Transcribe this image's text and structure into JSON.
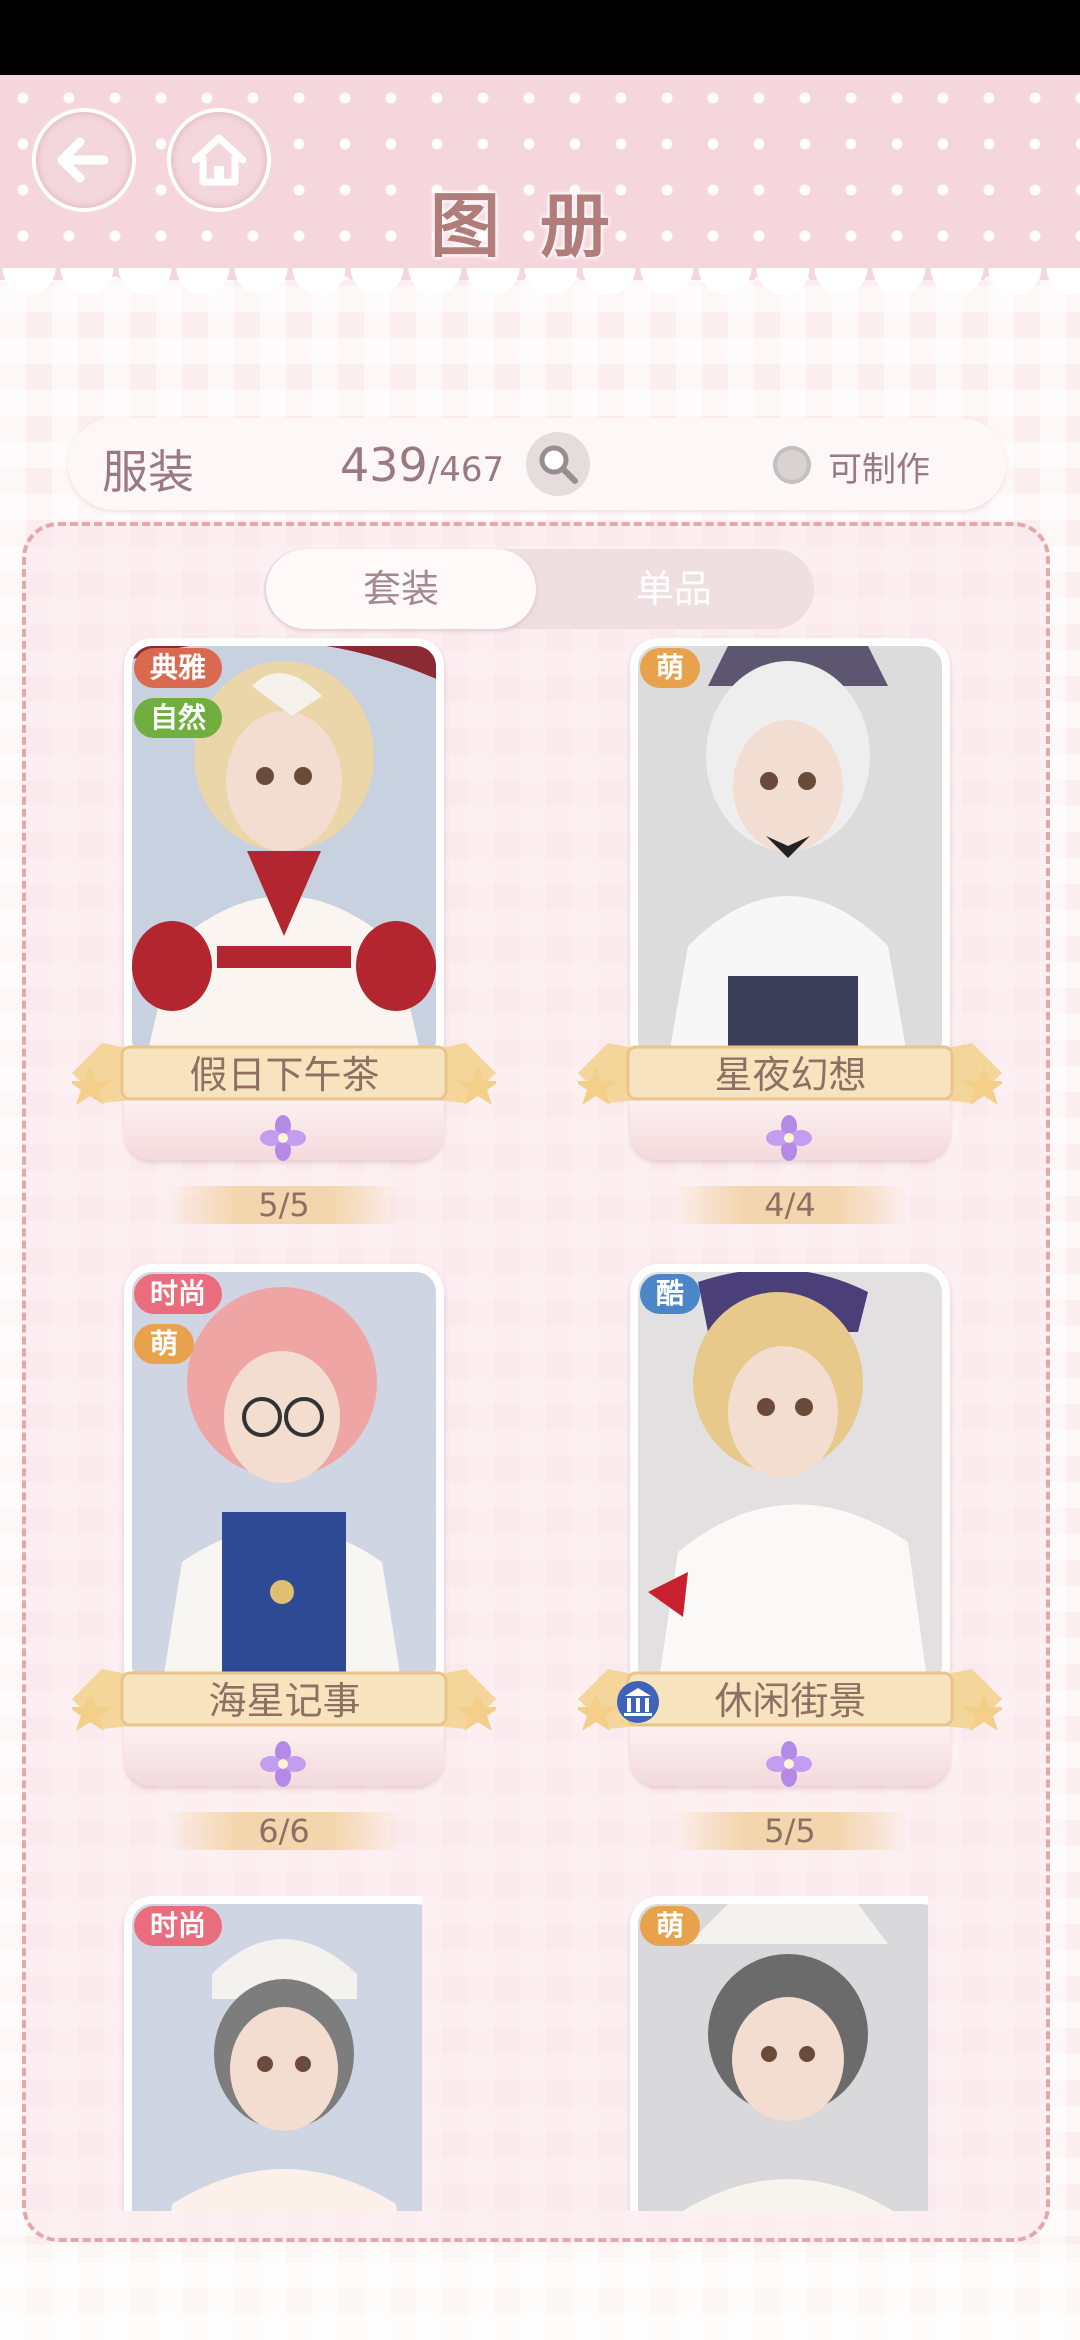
{
  "header": {
    "title": "图册"
  },
  "stats": {
    "category": "服装",
    "owned": "439",
    "total": "467",
    "craftable_label": "可制作"
  },
  "tabs": [
    {
      "label": "套装",
      "active": true
    },
    {
      "label": "单品",
      "active": false
    }
  ],
  "cards": [
    {
      "name": "假日下午茶",
      "tags": [
        "典雅",
        "自然"
      ],
      "progress": "5/5"
    },
    {
      "name": "星夜幻想",
      "tags": [
        "萌"
      ],
      "progress": "4/4"
    },
    {
      "name": "海星记事",
      "tags": [
        "时尚",
        "萌"
      ],
      "progress": "6/6"
    },
    {
      "name": "休闲街景",
      "tags": [
        "酷"
      ],
      "progress": "5/5"
    },
    {
      "name": "",
      "tags": [
        "时尚"
      ],
      "progress": ""
    },
    {
      "name": "",
      "tags": [
        "萌"
      ],
      "progress": ""
    }
  ],
  "colors": {
    "header_pink": "#f6d6dd",
    "title": "#b07d7a",
    "tag_elegant": "#d9694f",
    "tag_nature": "#6fae3f",
    "tag_cute": "#e8a24c",
    "tag_fashion": "#e96d7c",
    "tag_cool": "#4b86c9"
  },
  "icons": {
    "back": "arrow-left-icon",
    "home": "home-icon",
    "search": "magnifier-icon",
    "flower": "flower-icon"
  }
}
